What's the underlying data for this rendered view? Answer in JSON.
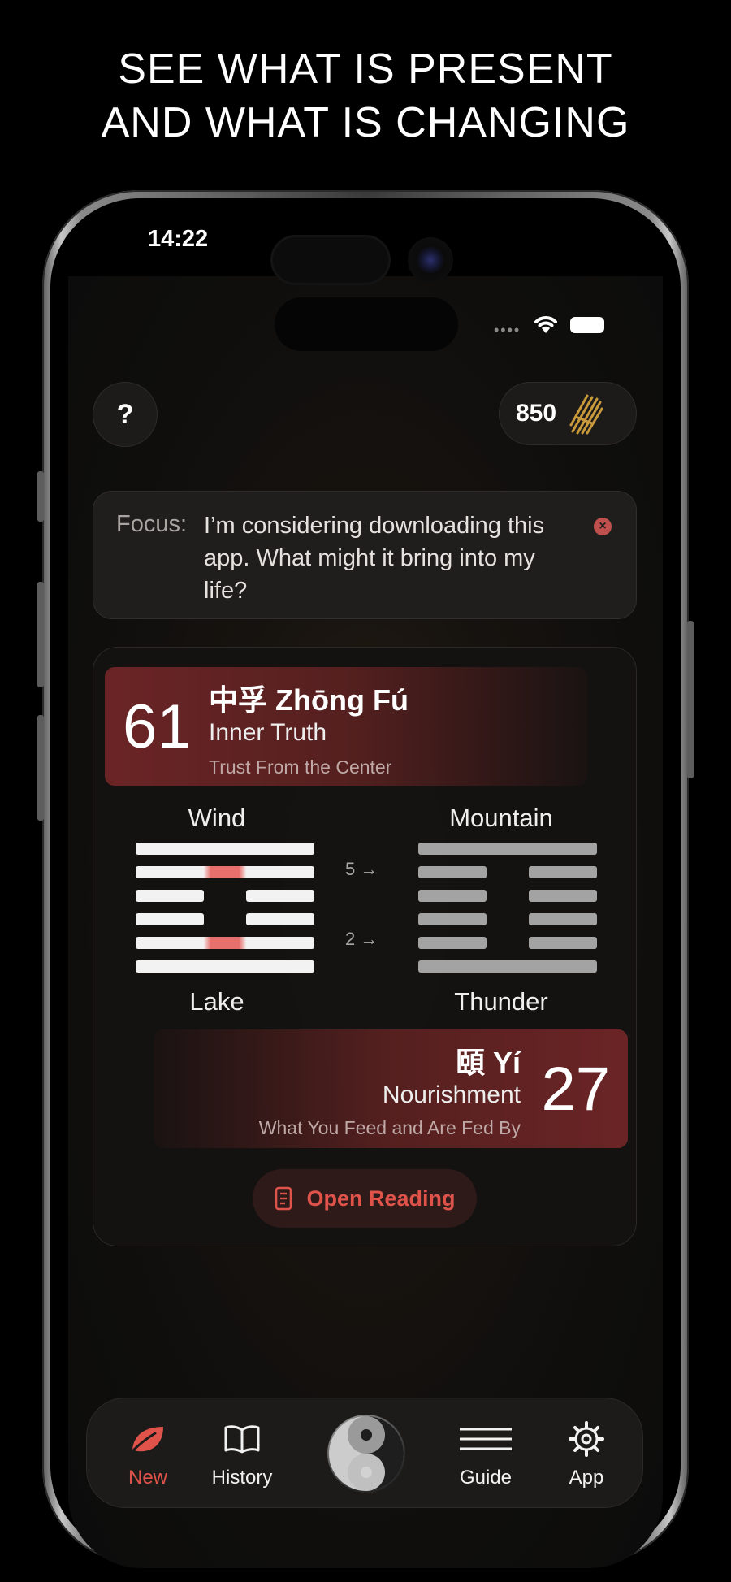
{
  "headline": {
    "line1": "SEE WHAT IS PRESENT",
    "line2": "AND WHAT IS CHANGING"
  },
  "status_bar": {
    "time": "14:22",
    "icons": [
      "cellular-dots-icon",
      "wifi-icon",
      "battery-icon"
    ]
  },
  "top_bar": {
    "help_label": "?",
    "coins_value": "850",
    "coins_icon": "yarrow-stalks-icon"
  },
  "focus": {
    "label": "Focus:",
    "text": "I’m considering downloading this app. What might it bring into my life?",
    "clear_icon": "clear-icon"
  },
  "reading": {
    "primary": {
      "number": "61",
      "title": "中孚 Zhōng Fú",
      "name": "Inner Truth",
      "subtitle": "Trust From the Center",
      "upper_trigram": "Wind",
      "lower_trigram": "Lake"
    },
    "changing_lines": [
      {
        "label": "5 →"
      },
      {
        "label": "2 →"
      }
    ],
    "relating": {
      "number": "27",
      "title": "頤 Yí",
      "name": "Nourishment",
      "subtitle": "What You Feed and Are Fed By",
      "upper_trigram": "Mountain",
      "lower_trigram": "Thunder"
    },
    "open_button": {
      "label": "Open Reading",
      "icon": "document-icon"
    }
  },
  "tabbar": {
    "items": [
      {
        "label": "New",
        "icon": "leaf-icon",
        "active": true
      },
      {
        "label": "History",
        "icon": "book-icon",
        "active": false
      },
      {
        "label": "",
        "icon": "yin-yang-icon",
        "active": false
      },
      {
        "label": "Guide",
        "icon": "menu-lines-icon",
        "active": false
      },
      {
        "label": "App",
        "icon": "gear-icon",
        "active": false
      }
    ]
  },
  "colors": {
    "accent": "#e0534a",
    "banner": "#6b2426",
    "line_primary": "#f2f2f2",
    "line_relating": "#a3a3a3",
    "changing_glow": "#e8706c"
  }
}
